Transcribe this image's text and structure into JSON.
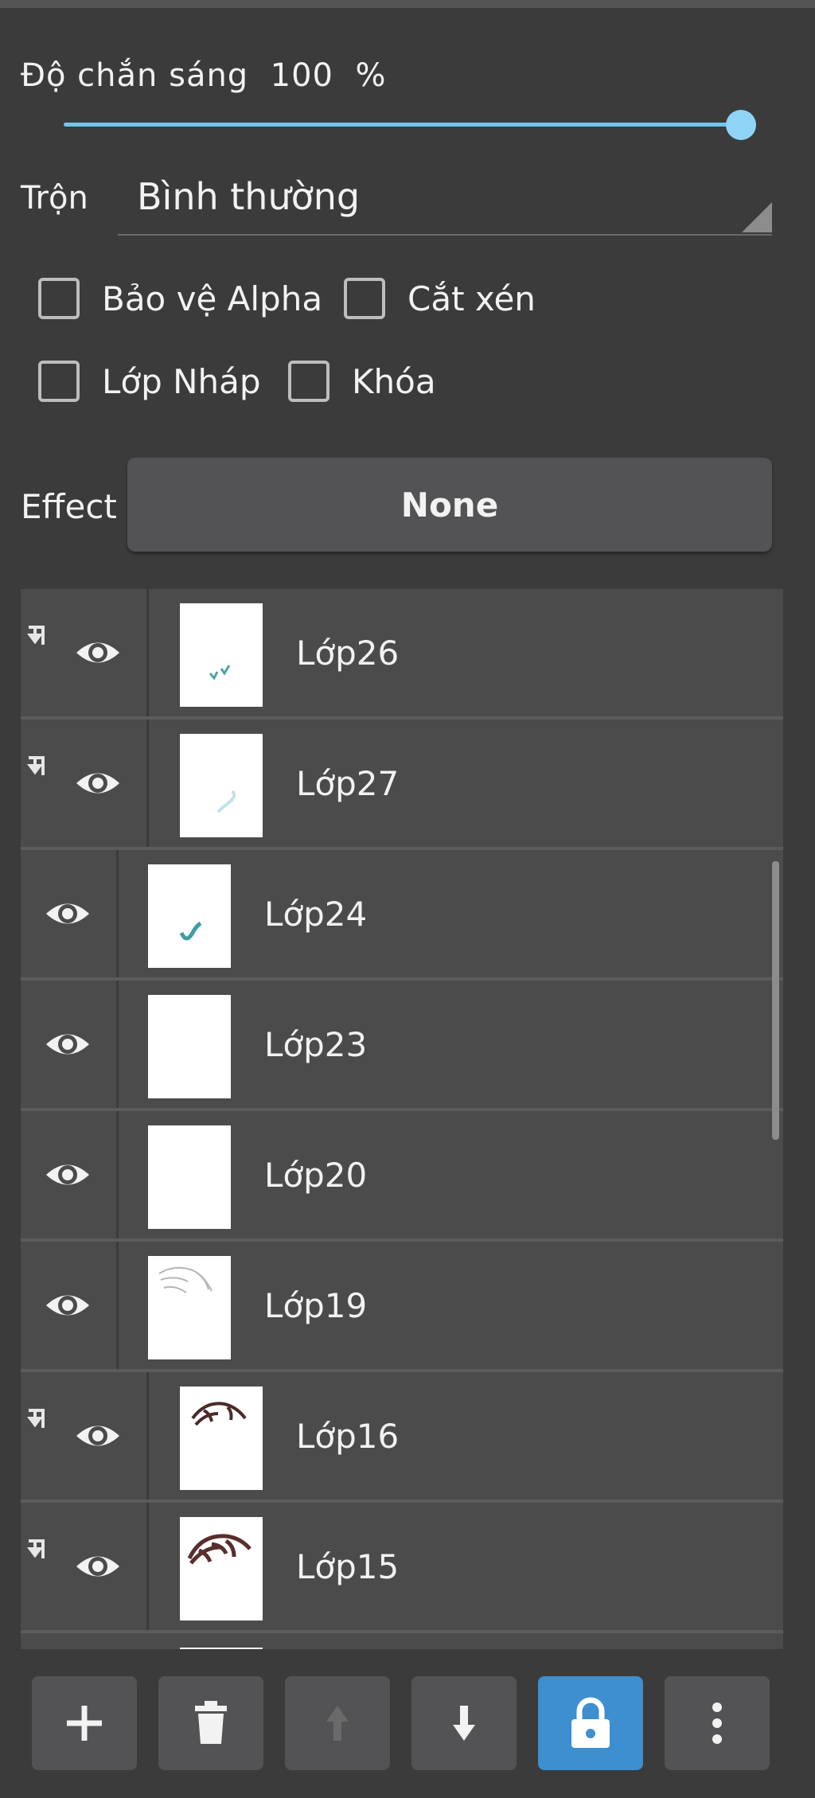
{
  "opacity": {
    "label": "Độ chắn sáng",
    "value": "100",
    "unit": "%",
    "level": 1.0
  },
  "blend": {
    "label": "Trộn",
    "value": "Bình thường"
  },
  "options": [
    {
      "label": "Bảo vệ Alpha",
      "checked": false
    },
    {
      "label": "Cắt xén",
      "checked": false
    },
    {
      "label": "Lớp Nháp",
      "checked": false
    },
    {
      "label": "Khóa",
      "checked": false
    }
  ],
  "effect": {
    "label": "Effect",
    "value": "None"
  },
  "layers": [
    {
      "name": "Lớp26",
      "clipped": true,
      "visible": true
    },
    {
      "name": "Lớp27",
      "clipped": true,
      "visible": true
    },
    {
      "name": "Lớp24",
      "clipped": false,
      "visible": true
    },
    {
      "name": "Lớp23",
      "clipped": false,
      "visible": true
    },
    {
      "name": "Lớp20",
      "clipped": false,
      "visible": true
    },
    {
      "name": "Lớp19",
      "clipped": false,
      "visible": true
    },
    {
      "name": "Lớp16",
      "clipped": true,
      "visible": true
    },
    {
      "name": "Lớp15",
      "clipped": true,
      "visible": true
    }
  ],
  "toolbar": [
    "add-icon",
    "trash-icon",
    "arrow-up-icon",
    "arrow-down-icon",
    "lock-icon",
    "more-vertical-icon"
  ],
  "colors": {
    "accent": "#74c4ee",
    "active_button": "#3d8fcf",
    "panel": "#3b3b3b",
    "row": "#4b4b4b"
  }
}
